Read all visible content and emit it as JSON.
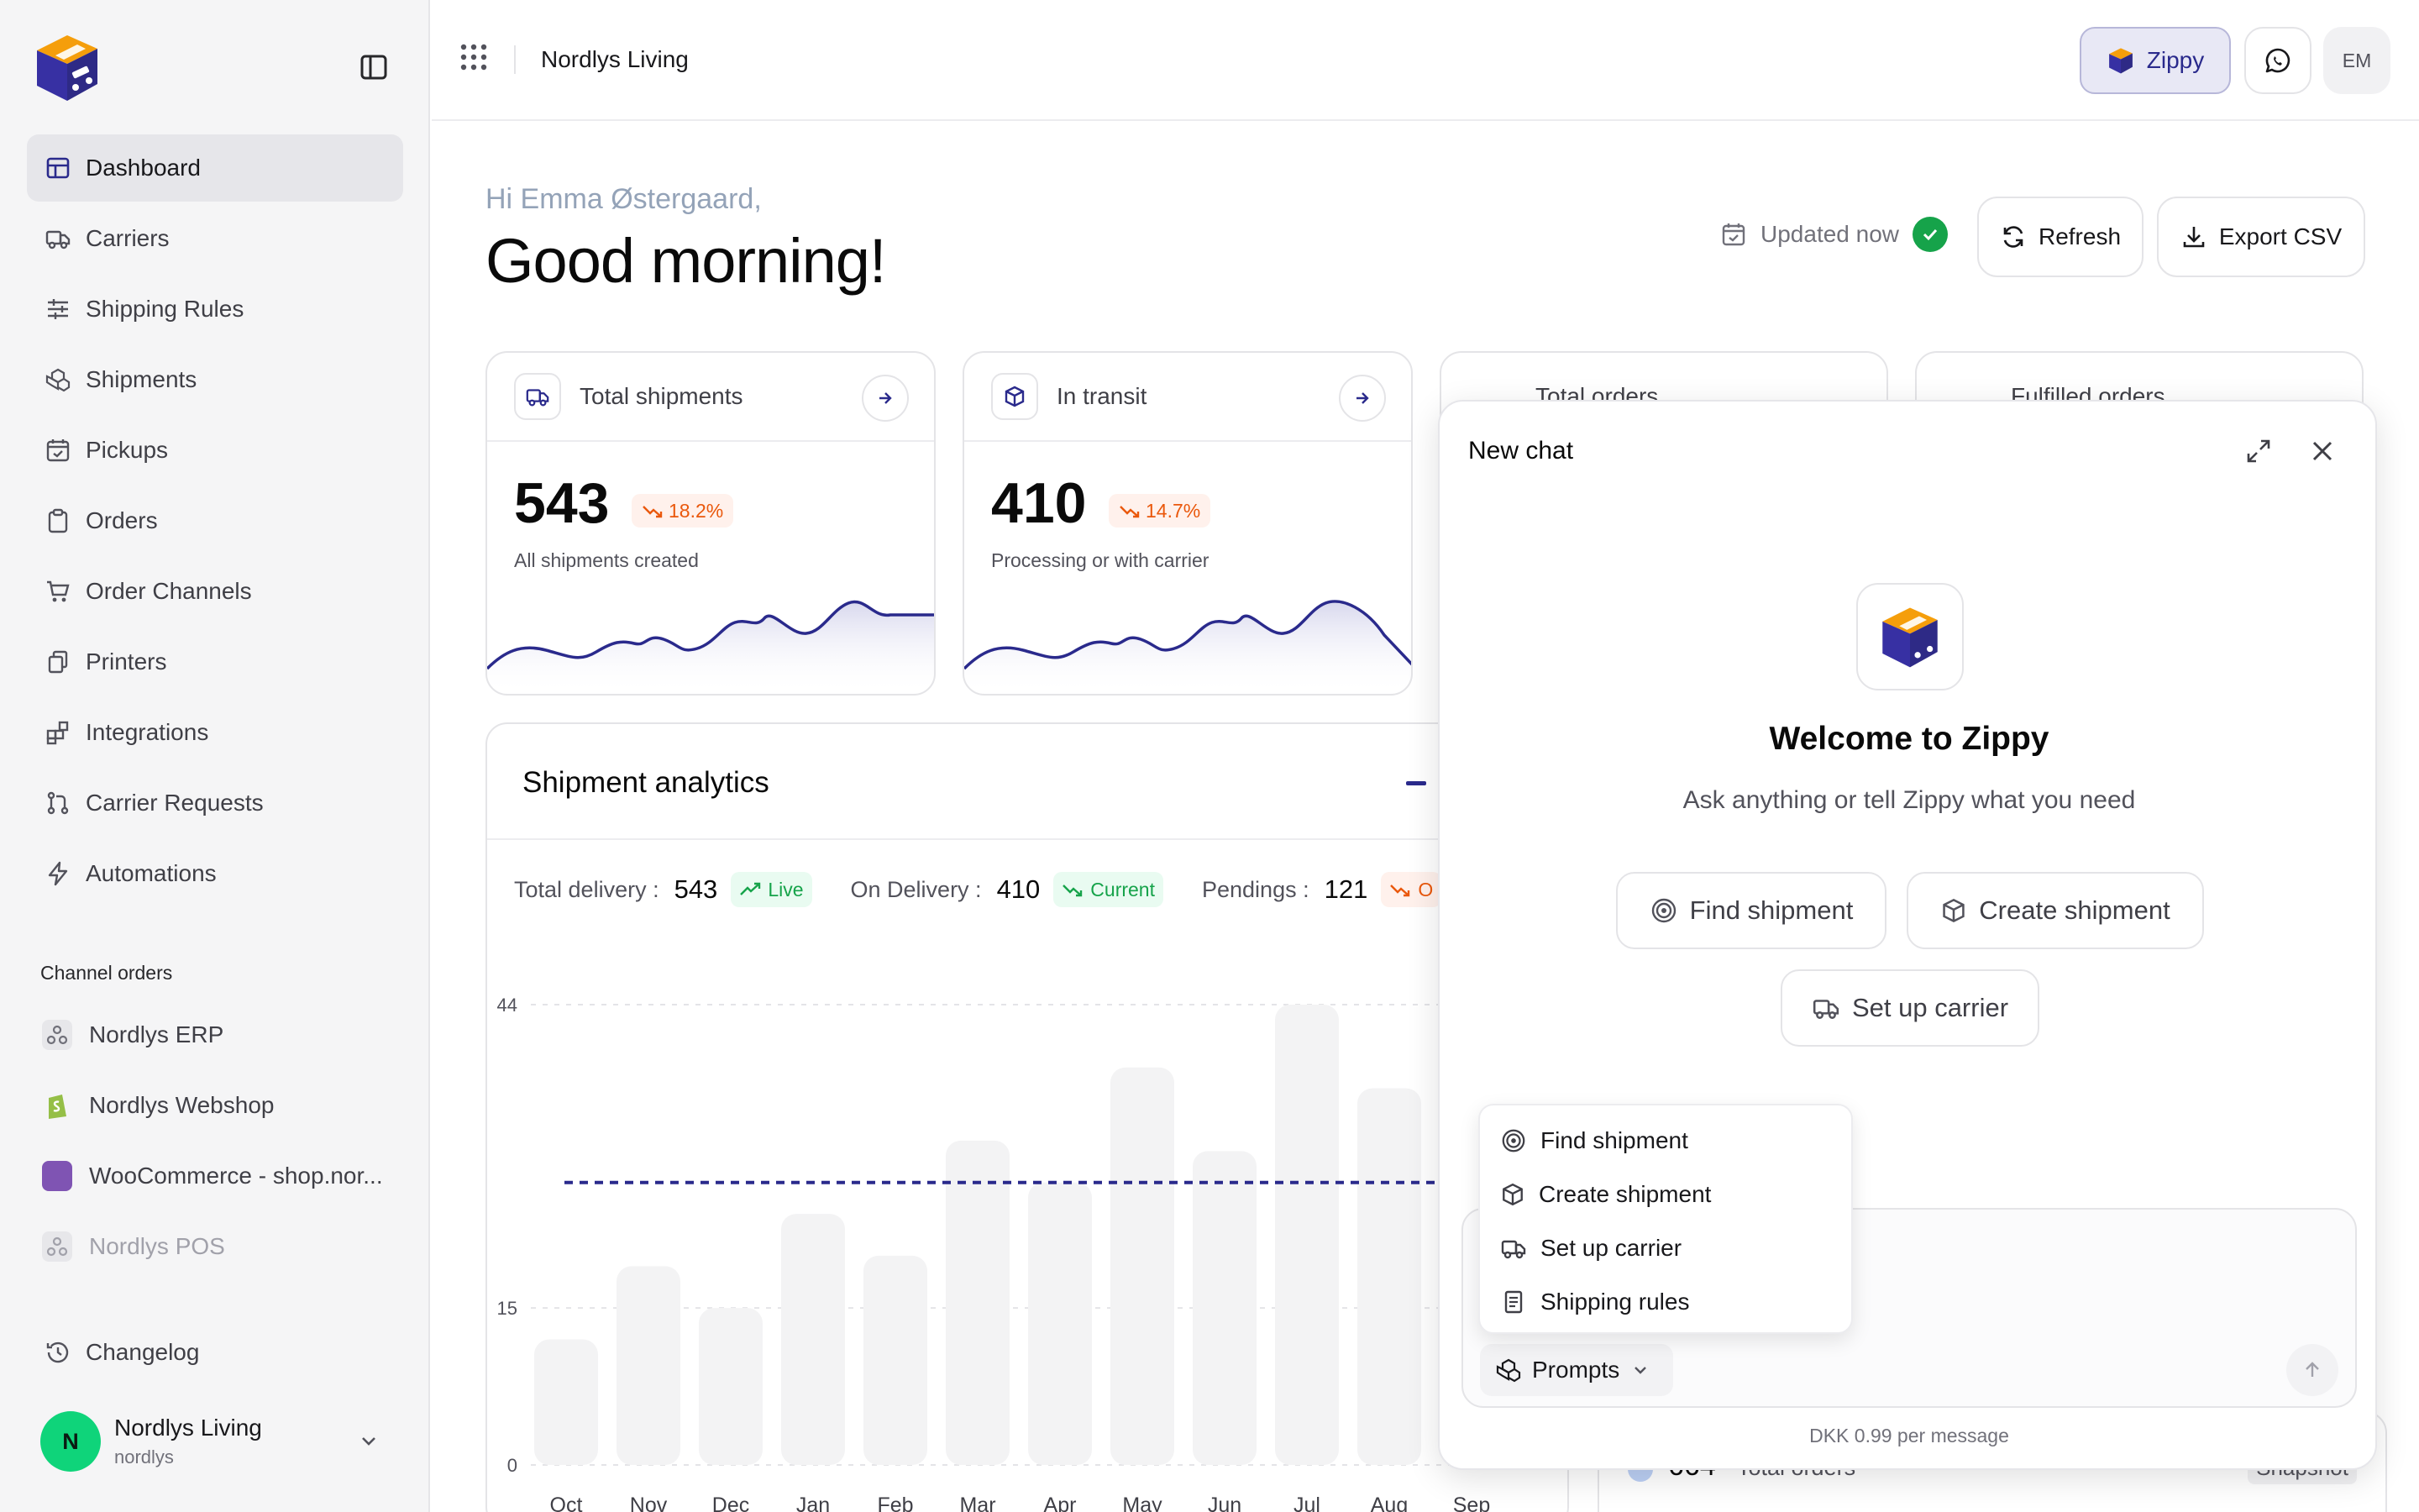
{
  "sidebar": {
    "items": [
      {
        "label": "Dashboard",
        "icon": "dashboard-icon"
      },
      {
        "label": "Carriers",
        "icon": "truck-icon"
      },
      {
        "label": "Shipping Rules",
        "icon": "sliders-icon"
      },
      {
        "label": "Shipments",
        "icon": "boxes-icon"
      },
      {
        "label": "Pickups",
        "icon": "calendar-check-icon"
      },
      {
        "label": "Orders",
        "icon": "clipboard-icon"
      },
      {
        "label": "Order Channels",
        "icon": "cart-icon"
      },
      {
        "label": "Printers",
        "icon": "printer-icon"
      },
      {
        "label": "Integrations",
        "icon": "integrations-icon"
      },
      {
        "label": "Carrier Requests",
        "icon": "git-pull-icon"
      },
      {
        "label": "Automations",
        "icon": "bolt-icon"
      }
    ],
    "channels_label": "Channel orders",
    "channels": [
      {
        "label": "Nordlys ERP",
        "icon": "webhook-icon"
      },
      {
        "label": "Nordlys Webshop",
        "icon": "shopify-icon"
      },
      {
        "label": "WooCommerce - shop.nor...",
        "icon": "woocommerce-icon"
      },
      {
        "label": "Nordlys POS",
        "icon": "webhook-icon"
      }
    ],
    "changelog": "Changelog",
    "account": {
      "initial": "N",
      "name": "Nordlys Living",
      "handle": "nordlys"
    }
  },
  "topbar": {
    "org": "Nordlys Living",
    "zippy": "Zippy",
    "user_initials": "EM"
  },
  "greeting": {
    "sub": "Hi Emma Østergaard,",
    "main": "Good morning!"
  },
  "status": {
    "updated": "Updated now",
    "refresh": "Refresh",
    "export": "Export CSV"
  },
  "stats": [
    {
      "title": "Total shipments",
      "value": "543",
      "trend": "18.2%",
      "desc": "All shipments created"
    },
    {
      "title": "In transit",
      "value": "410",
      "trend": "14.7%",
      "desc": "Processing or with carrier"
    },
    {
      "title": "Total orders"
    },
    {
      "title": "Fulfilled orders"
    }
  ],
  "analytics": {
    "title": "Shipment analytics",
    "metrics": [
      {
        "label": "Total delivery :",
        "value": "543",
        "badge": "Live",
        "tone": "green"
      },
      {
        "label": "On Delivery :",
        "value": "410",
        "badge": "Current",
        "tone": "green"
      },
      {
        "label": "Pendings :",
        "value": "121",
        "badge": "O",
        "tone": "orange"
      }
    ]
  },
  "chart_data": {
    "type": "bar",
    "categories": [
      "Oct",
      "Nov",
      "Dec",
      "Jan",
      "Feb",
      "Mar",
      "Apr",
      "May",
      "Jun",
      "Jul",
      "Aug",
      "Sep"
    ],
    "values": [
      12,
      19,
      15,
      24,
      20,
      31,
      27,
      38,
      30,
      44,
      36,
      0
    ],
    "yticks": [
      "0",
      "15",
      "44"
    ],
    "ylim": [
      0,
      44
    ],
    "average": 27,
    "grid": true,
    "xlabel": "",
    "ylabel": "",
    "title": ""
  },
  "bottom_peek": {
    "value": "664",
    "label": "Total orders",
    "badge": "Snapshot"
  },
  "chat": {
    "title": "New chat",
    "welcome_title": "Welcome to Zippy",
    "welcome_sub": "Ask anything or tell Zippy what you need",
    "chips": [
      "Find shipment",
      "Create shipment",
      "Set up carrier"
    ],
    "menu": [
      "Find shipment",
      "Create shipment",
      "Set up carrier",
      "Shipping rules"
    ],
    "prompts": "Prompts",
    "price": "DKK 0.99 per message"
  },
  "colors": {
    "accent": "#2a2a8c",
    "brand_orange": "#f59e0b",
    "positive": "#16a34a",
    "negative": "#ea580c"
  }
}
